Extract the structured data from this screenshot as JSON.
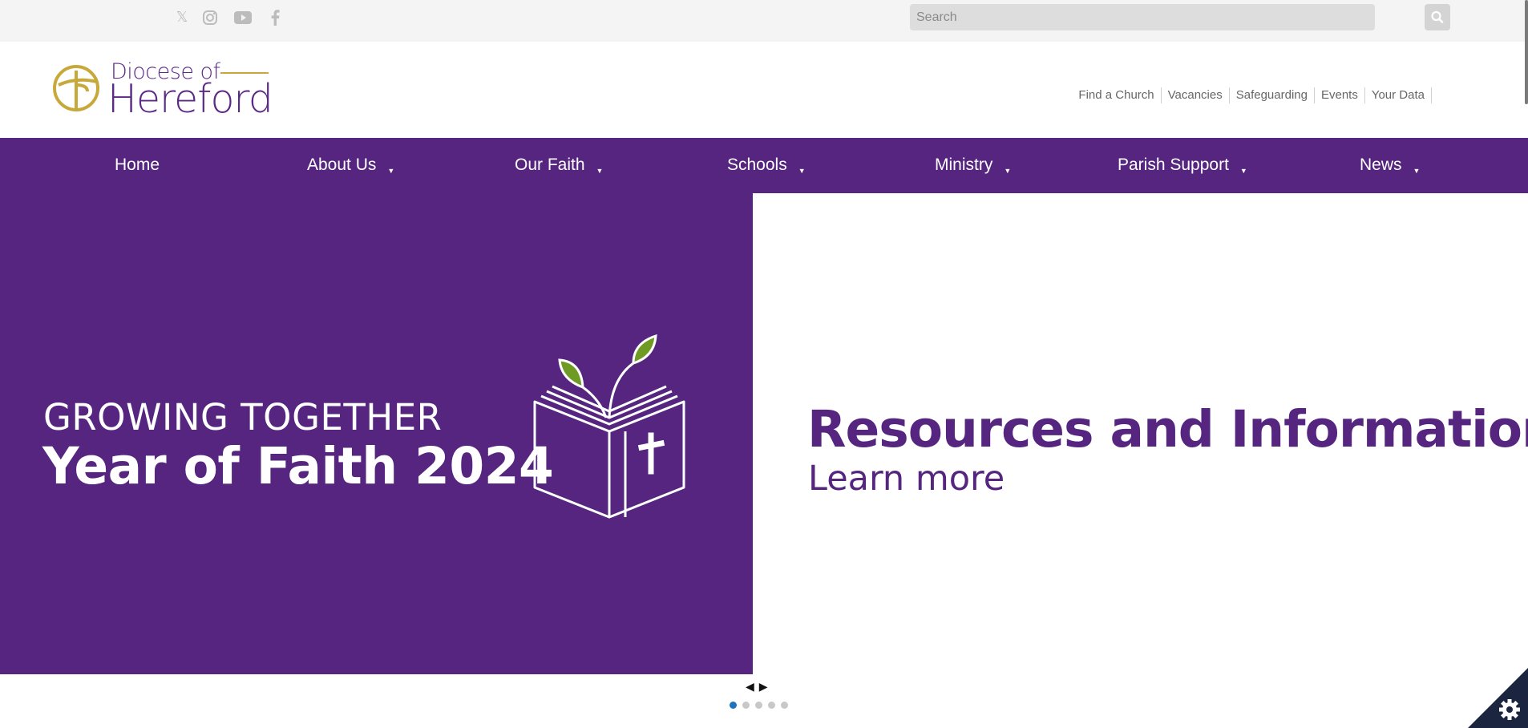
{
  "social": [
    {
      "name": "x-twitter",
      "glyph": "𝕏"
    },
    {
      "name": "instagram",
      "glyph": ""
    },
    {
      "name": "youtube",
      "glyph": ""
    },
    {
      "name": "facebook",
      "glyph": "f"
    }
  ],
  "search": {
    "placeholder": "Search",
    "value": ""
  },
  "logo": {
    "line1": "Diocese of",
    "line2": "Hereford"
  },
  "util_links": [
    "Find a Church",
    "Vacancies",
    "Safeguarding",
    "Events",
    "Your Data"
  ],
  "nav": [
    {
      "label": "Home",
      "has_dropdown": false
    },
    {
      "label": "About Us",
      "has_dropdown": true
    },
    {
      "label": "Our Faith",
      "has_dropdown": true
    },
    {
      "label": "Schools",
      "has_dropdown": true
    },
    {
      "label": "Ministry",
      "has_dropdown": true
    },
    {
      "label": "Parish Support",
      "has_dropdown": true
    },
    {
      "label": "News",
      "has_dropdown": true
    }
  ],
  "hero": {
    "left": {
      "kicker": "GROWING TOGETHER",
      "title": "Year of Faith 2024"
    },
    "right": {
      "title": "Resources and Information",
      "cta": "Learn more"
    }
  },
  "slider": {
    "prev": "◀",
    "next": "▶",
    "slide_count": 5,
    "active_slide": 1
  },
  "colors": {
    "brand_purple": "#55257f",
    "gold": "#c7a93a",
    "leaf_green": "#6f9a24",
    "active_dot": "#1e73be"
  }
}
